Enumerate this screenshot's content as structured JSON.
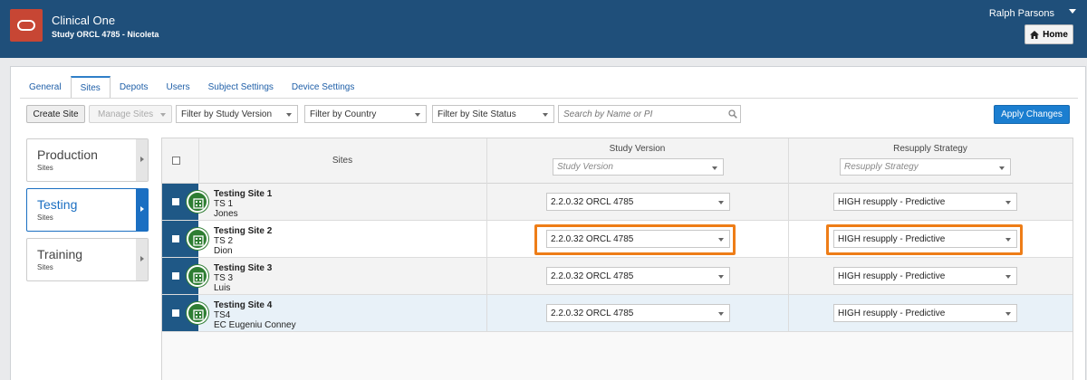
{
  "header": {
    "app_title": "Clinical One",
    "study_title": "Study ORCL 4785 - Nicoleta",
    "user_name": "Ralph Parsons",
    "home_label": "Home",
    "bg_color": "#1f4f7a",
    "logo_color": "#c74634"
  },
  "tabs": [
    {
      "label": "General"
    },
    {
      "label": "Sites",
      "active": true
    },
    {
      "label": "Depots"
    },
    {
      "label": "Users"
    },
    {
      "label": "Subject Settings"
    },
    {
      "label": "Device Settings"
    }
  ],
  "toolbar": {
    "create_site": "Create Site",
    "manage_sites": "Manage Sites",
    "filter_study_version": "Filter by Study Version",
    "filter_country": "Filter by Country",
    "filter_site_status": "Filter by Site Status",
    "search_placeholder": "Search by Name or PI",
    "apply_changes": "Apply Changes"
  },
  "environments": [
    {
      "name": "Production",
      "sub": "Sites"
    },
    {
      "name": "Testing",
      "sub": "Sites",
      "active": true
    },
    {
      "name": "Training",
      "sub": "Sites"
    }
  ],
  "table": {
    "col_sites": "Sites",
    "col_study_version": "Study Version",
    "col_resupply": "Resupply Strategy",
    "study_version_placeholder": "Study Version",
    "resupply_placeholder": "Resupply Strategy",
    "rows": [
      {
        "name": "Testing Site 1",
        "code": "TS 1",
        "pi": "Jones",
        "version": "2.2.0.32 ORCL 4785",
        "strategy": "HIGH resupply - Predictive"
      },
      {
        "name": "Testing Site 2",
        "code": "TS 2",
        "pi": "Dion",
        "version": "2.2.0.32 ORCL 4785",
        "strategy": "HIGH resupply - Predictive"
      },
      {
        "name": "Testing Site 3",
        "code": "TS 3",
        "pi": "Luis",
        "version": "2.2.0.32 ORCL 4785",
        "strategy": "HIGH resupply - Predictive"
      },
      {
        "name": "Testing Site 4",
        "code": "TS4",
        "pi": "EC Eugeniu Conney",
        "version": "2.2.0.32 ORCL 4785",
        "strategy": "HIGH resupply - Predictive"
      }
    ]
  },
  "colors": {
    "accent": "#1b7ed0",
    "highlight": "#ee7d17",
    "site_icon": "#2e7d32",
    "row_stripe": "#1f5886"
  }
}
